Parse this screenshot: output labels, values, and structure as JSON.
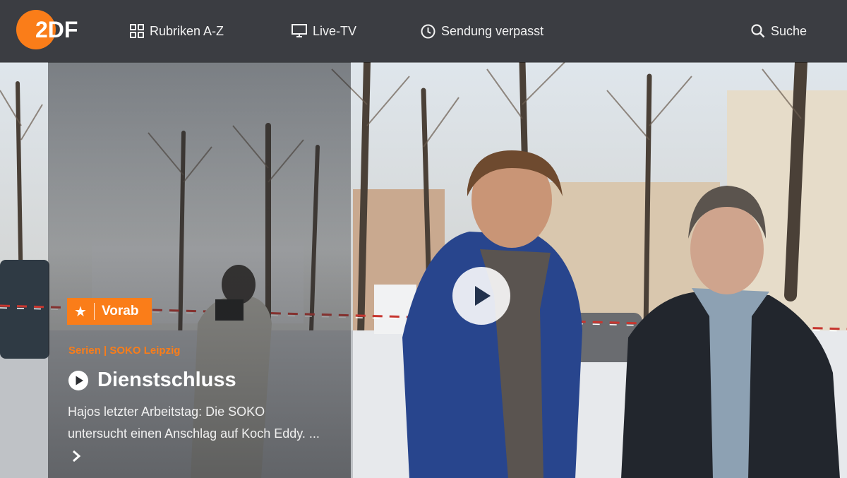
{
  "header": {
    "logo_text": "ZDF",
    "nav": [
      {
        "label": "Rubriken A-Z",
        "icon": "grid-icon"
      },
      {
        "label": "Live-TV",
        "icon": "tv-icon"
      },
      {
        "label": "Sendung verpasst",
        "icon": "clock-icon"
      }
    ],
    "search_label": "Suche",
    "search_icon": "search-icon"
  },
  "hero": {
    "badge_label": "Vorab",
    "badge_icon": "star-icon",
    "category": "Serien | SOKO Leipzig",
    "title": "Dienstschluss",
    "description": "Hajos letzter Arbeitstag: Die SOKO untersucht einen Anschlag auf Koch Eddy. ...",
    "colors": {
      "accent": "#fa7d19",
      "header_bg": "#3b3d42"
    }
  }
}
